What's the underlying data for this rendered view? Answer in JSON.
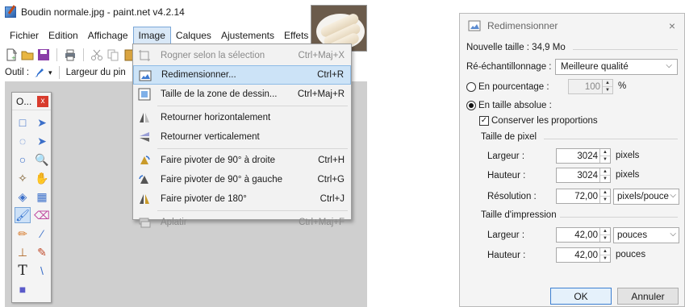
{
  "app": {
    "title": "Boudin normale.jpg - paint.net v4.2.14"
  },
  "menubar": {
    "items": [
      "Fichier",
      "Edition",
      "Affichage",
      "Image",
      "Calques",
      "Ajustements",
      "Effets"
    ]
  },
  "tool_options": {
    "tool_label": "Outil :",
    "brush_width_label": "Largeur du pin"
  },
  "tools_window": {
    "title": "O...",
    "close": "x",
    "tools": [
      {
        "name": "rectangle-select-icon",
        "glyph": "□"
      },
      {
        "name": "move-selection-icon",
        "glyph": "➤"
      },
      {
        "name": "lasso-select-icon",
        "glyph": "◌"
      },
      {
        "name": "move-selected-icon",
        "glyph": "➤"
      },
      {
        "name": "ellipse-select-icon",
        "glyph": "○"
      },
      {
        "name": "zoom-icon",
        "glyph": "🔍"
      },
      {
        "name": "magic-wand-icon",
        "glyph": "✧"
      },
      {
        "name": "pan-icon",
        "glyph": "✋"
      },
      {
        "name": "paint-bucket-icon",
        "glyph": "◈"
      },
      {
        "name": "gradient-icon",
        "glyph": "▦"
      },
      {
        "name": "paintbrush-icon",
        "glyph": "🖌"
      },
      {
        "name": "eraser-icon",
        "glyph": "⌫"
      },
      {
        "name": "pencil-icon",
        "glyph": "✏"
      },
      {
        "name": "color-picker-icon",
        "glyph": "⁄"
      },
      {
        "name": "clone-stamp-icon",
        "glyph": "⊥"
      },
      {
        "name": "recolor-icon",
        "glyph": "✎"
      },
      {
        "name": "text-icon",
        "glyph": "T"
      },
      {
        "name": "line-curve-icon",
        "glyph": "\\"
      },
      {
        "name": "shapes-icon",
        "glyph": "■"
      }
    ]
  },
  "image_menu": {
    "items": [
      {
        "label": "Rogner selon la sélection",
        "shortcut": "Ctrl+Maj+X",
        "disabled": true,
        "icon": "crop-icon"
      },
      {
        "label": "Redimensionner...",
        "shortcut": "Ctrl+R",
        "highlighted": true,
        "icon": "resize-image-icon"
      },
      {
        "label": "Taille de la zone de dessin...",
        "shortcut": "Ctrl+Maj+R",
        "icon": "canvas-size-icon"
      },
      {
        "separator": true
      },
      {
        "label": "Retourner horizontalement",
        "shortcut": "",
        "icon": "flip-horizontal-icon"
      },
      {
        "label": "Retourner verticalement",
        "shortcut": "",
        "icon": "flip-vertical-icon"
      },
      {
        "separator": true
      },
      {
        "label": "Faire pivoter de 90° à droite",
        "shortcut": "Ctrl+H",
        "icon": "rotate-right-icon"
      },
      {
        "label": "Faire pivoter de 90° à gauche",
        "shortcut": "Ctrl+G",
        "icon": "rotate-left-icon"
      },
      {
        "label": "Faire pivoter de 180°",
        "shortcut": "Ctrl+J",
        "icon": "rotate-180-icon"
      },
      {
        "separator": true
      },
      {
        "label": "Aplatir",
        "shortcut": "Ctrl+Maj+F",
        "disabled": true,
        "icon": "flatten-icon"
      }
    ]
  },
  "resize_dialog": {
    "title": "Redimensionner",
    "close": "×",
    "new_size": "Nouvelle taille : 34,9 Mo",
    "resampling_label": "Ré-échantillonnage :",
    "resampling_value": "Meilleure qualité",
    "by_percentage_label": "En pourcentage :",
    "percentage_value": "100",
    "percent_unit": "%",
    "by_absolute_label": "En taille absolue :",
    "keep_ratio_label": "Conserver les proportions",
    "pixel_size_label": "Taille de pixel",
    "width_label": "Largeur :",
    "width_value": "3024",
    "height_label": "Hauteur :",
    "height_value": "3024",
    "pixels_unit": "pixels",
    "resolution_label": "Résolution :",
    "resolution_value": "72,00",
    "resolution_unit": "pixels/pouce",
    "print_size_label": "Taille d'impression",
    "print_width_label": "Largeur :",
    "print_width_value": "42,00",
    "print_width_unit": "pouces",
    "print_height_label": "Hauteur :",
    "print_height_value": "42,00",
    "print_height_unit": "pouces",
    "ok_label": "OK",
    "cancel_label": "Annuler"
  }
}
